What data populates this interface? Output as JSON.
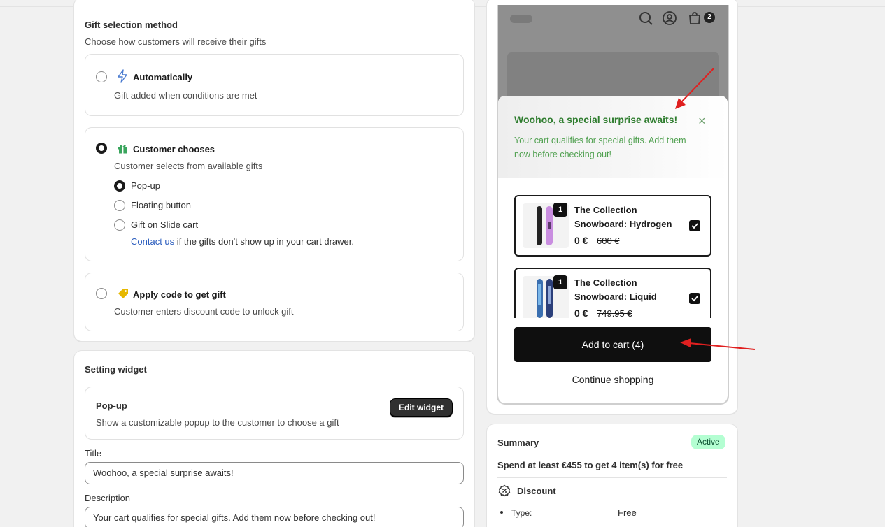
{
  "gift_method": {
    "title": "Gift selection method",
    "subtitle": "Choose how customers will receive their gifts",
    "options": [
      {
        "title": "Automatically",
        "desc": "Gift added when conditions are met"
      },
      {
        "title": "Customer chooses",
        "desc": "Customer selects from available gifts"
      },
      {
        "title": "Apply code to get gift",
        "desc": "Customer enters discount code to unlock gift"
      }
    ],
    "sub_options": [
      "Pop-up",
      "Floating button",
      "Gift on Slide cart"
    ],
    "contact_link": "Contact us",
    "contact_note": " if the gifts don't show up in your cart drawer."
  },
  "widget": {
    "title": "Setting widget",
    "popup_title": "Pop-up",
    "popup_desc": "Show a customizable popup to the customer to choose a gift",
    "edit_button": "Edit widget",
    "title_label": "Title",
    "title_value": "Woohoo, a special surprise awaits!",
    "desc_label": "Description",
    "desc_value": "Your cart qualifies for special gifts. Add them now before checking out!"
  },
  "preview": {
    "cart_count": "2",
    "popup_title": "Woohoo, a special surprise awaits!",
    "popup_desc": "Your cart qualifies for special gifts. Add them now before checking out!",
    "close": "×",
    "products": [
      {
        "qty": "1",
        "name": "The Collection Snowboard: Hydrogen",
        "price": "0 €",
        "old_price": "600 €"
      },
      {
        "qty": "1",
        "name": "The Collection Snowboard: Liquid",
        "price": "0 €",
        "old_price": "749.95 €"
      }
    ],
    "add_button": "Add to cart (4)",
    "continue": "Continue shopping"
  },
  "summary": {
    "title": "Summary",
    "status": "Active",
    "headline": "Spend at least €455 to get 4 item(s) for free",
    "discount_title": "Discount",
    "type_label": "Type:",
    "type_value": "Free"
  },
  "colors": {
    "accent_green": "#2f7d2f",
    "badge_green": "#b4fed2",
    "arrow_red": "#e02020"
  }
}
